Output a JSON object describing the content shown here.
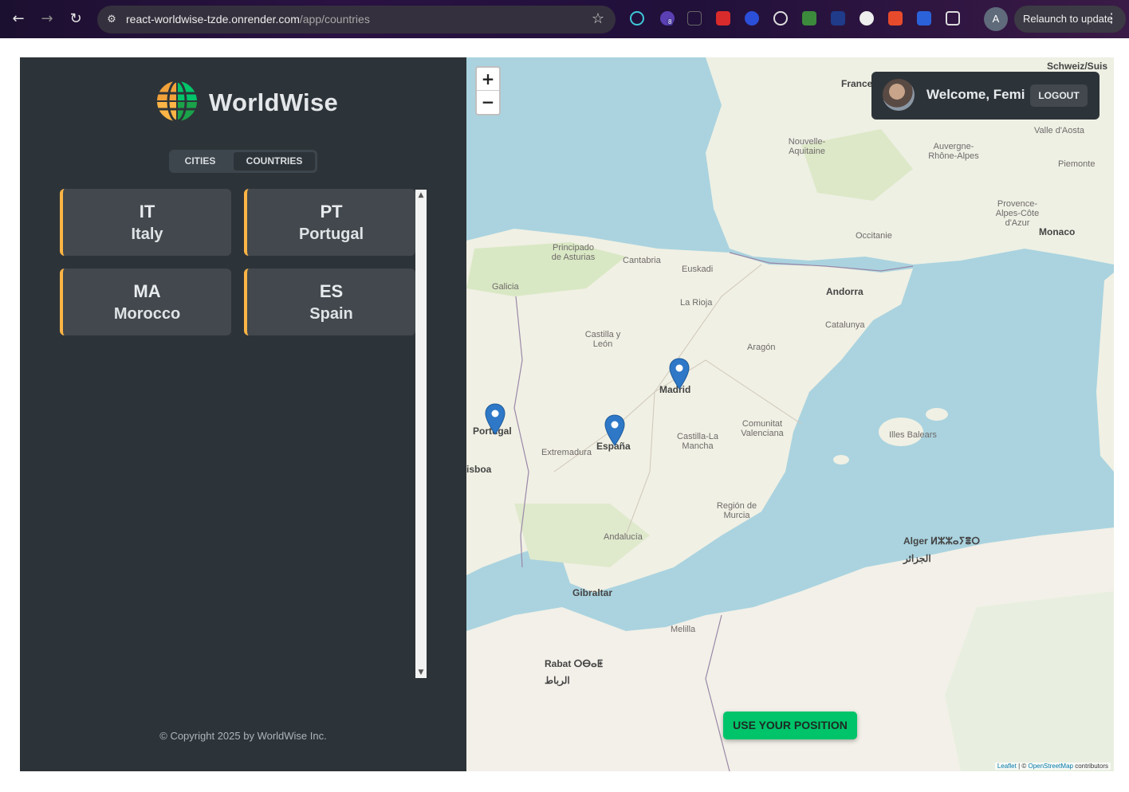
{
  "browser": {
    "url_host": "react-worldwise-tzde.onrender.com",
    "url_path": "/app/countries",
    "profile_initial": "A",
    "relaunch_label": "Relaunch to update",
    "extension_badge": "8"
  },
  "sidebar": {
    "brand": "WorldWise",
    "tabs": [
      {
        "label": "CITIES",
        "active": false
      },
      {
        "label": "COUNTRIES",
        "active": true
      }
    ],
    "countries": [
      {
        "code": "IT",
        "name": "Italy"
      },
      {
        "code": "PT",
        "name": "Portugal"
      },
      {
        "code": "MA",
        "name": "Morocco"
      },
      {
        "code": "ES",
        "name": "Spain"
      }
    ],
    "copyright": "© Copyright 2025 by WorldWise Inc."
  },
  "map": {
    "zoom_in": "+",
    "zoom_out": "−",
    "user": {
      "welcome": "Welcome, Femi",
      "logout": "LOGOUT"
    },
    "use_position": "USE YOUR POSITION",
    "attribution": {
      "leaflet": "Leaflet",
      "sep": " | © ",
      "osm": "OpenStreetMap",
      "tail": " contributors"
    },
    "labels": {
      "france": "France",
      "schweiz": "Schweiz/Suis",
      "nouvelle_aquitaine": "Nouvelle-Aquitaine",
      "occitanie": "Occitanie",
      "auvergne": "Auvergne-Rhône-Alpes",
      "provence": "Provence-Alpes-Côte d'Azur",
      "piemonte": "Piemonte",
      "valle": "Valle d'Aosta",
      "monaco": "Monaco",
      "andorra": "Andorra",
      "catalunya": "Catalunya",
      "aragon": "Aragón",
      "principado": "Principado de Asturias",
      "cantabria": "Cantabria",
      "euskadi": "Euskadi",
      "galicia": "Galicia",
      "la_rioja": "La Rioja",
      "castilla_leon": "Castilla y León",
      "madrid": "Madrid",
      "portugal": "Portugal",
      "espana": "España",
      "extremadura": "Extremadura",
      "castilla_mancha": "Castilla-La Mancha",
      "valenciana": "Comunitat Valenciana",
      "illes_balears": "Illes Balears",
      "lisboa": "isboa",
      "murcia": "Región de Murcia",
      "andalucia": "Andalucía",
      "gibraltar": "Gibraltar",
      "alger": "Alger ⵍⵣⵣⴰⵢⴻⵔ",
      "aljazair": "الجزائر",
      "melilla": "Melilla",
      "rabat": "Rabat ⵔⴱⴰⵟ",
      "rabat_ar": "الرباط"
    }
  }
}
